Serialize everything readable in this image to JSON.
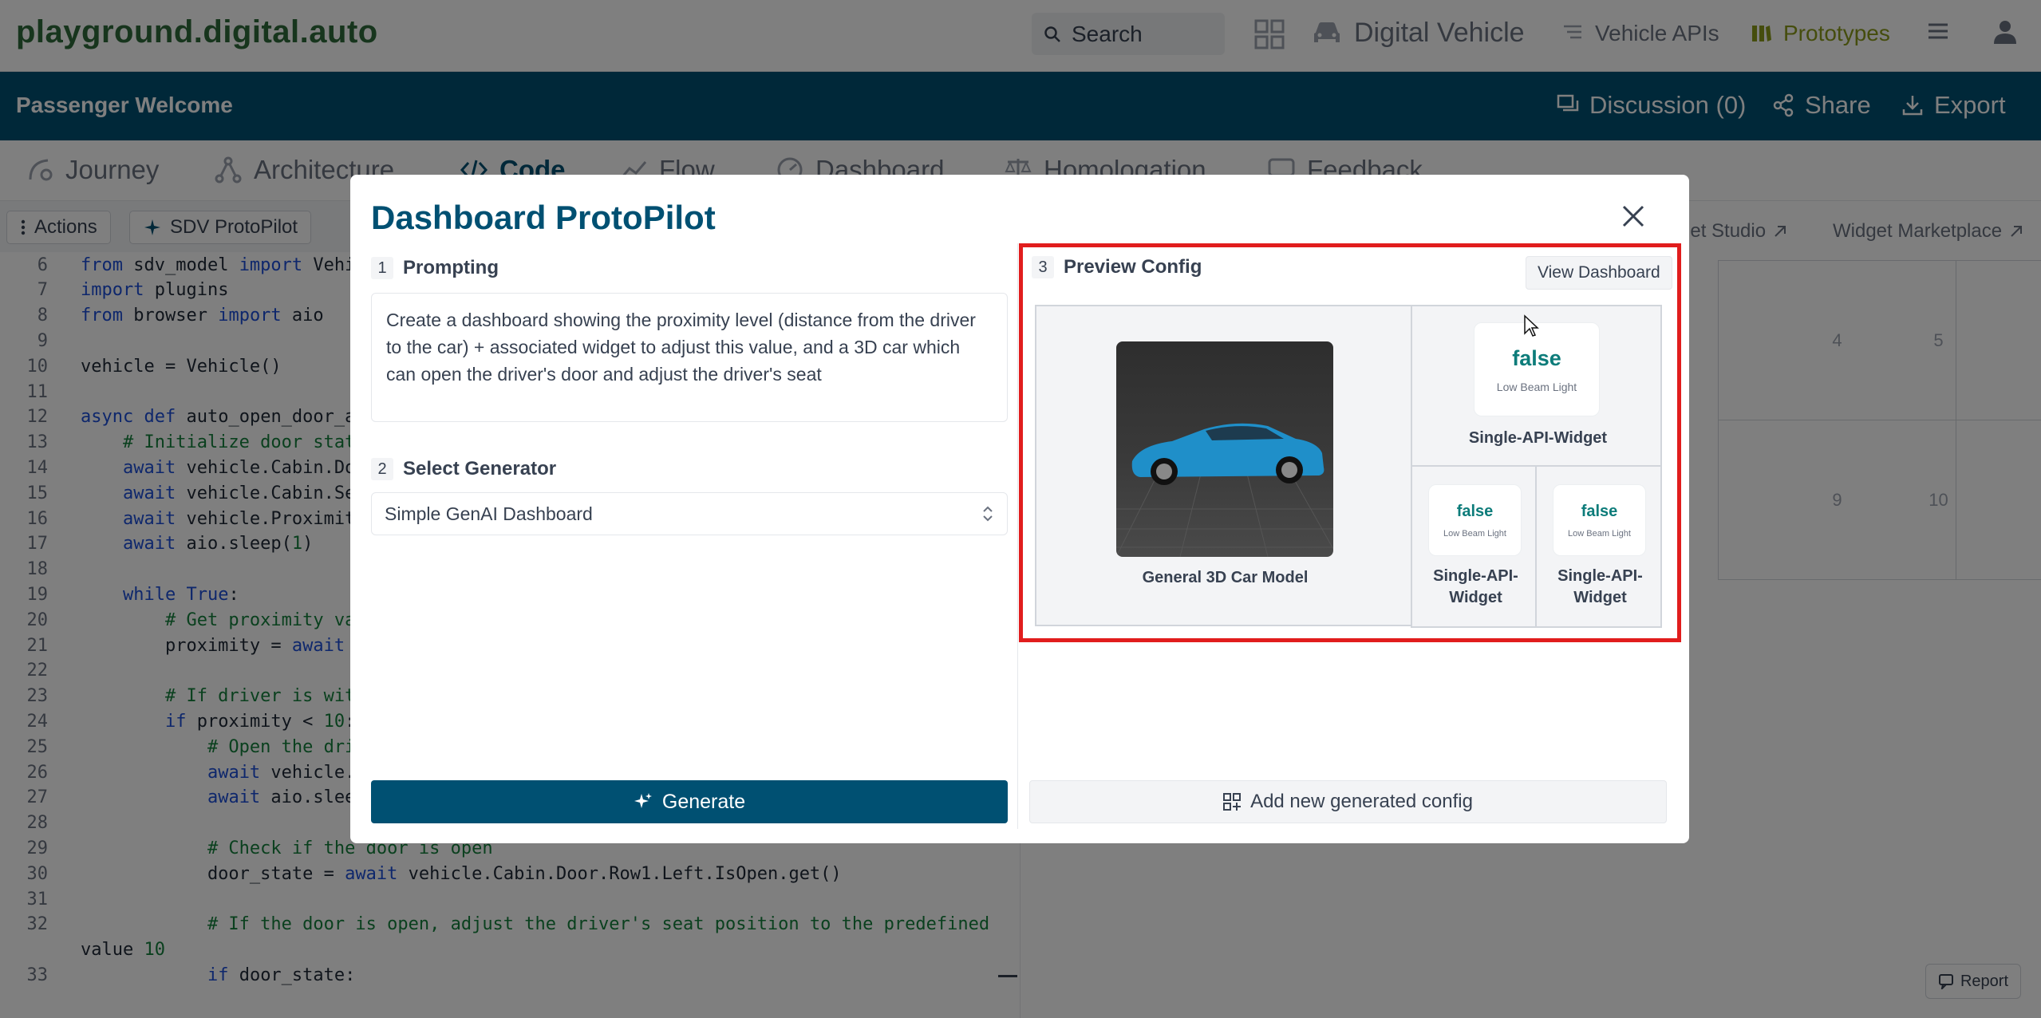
{
  "nav": {
    "logo": "playground.digital.auto",
    "search_label": "Search",
    "digital_vehicle": "Digital Vehicle",
    "vehicle_apis": "Vehicle APIs",
    "prototypes": "Prototypes"
  },
  "prototype": {
    "title": "Passenger Welcome",
    "discussion": "Discussion (0)",
    "share": "Share",
    "export": "Export"
  },
  "tabs": [
    "Journey",
    "Architecture",
    "Code",
    "Flow",
    "Dashboard",
    "Homologation",
    "Feedback"
  ],
  "code_toolbar": {
    "actions": "Actions",
    "protopilot": "SDV ProtoPilot"
  },
  "code_lines": [
    {
      "n": "6",
      "text": "from sdv_model import Vehi"
    },
    {
      "n": "7",
      "text": "import plugins"
    },
    {
      "n": "8",
      "text": "from browser import aio"
    },
    {
      "n": "9",
      "text": ""
    },
    {
      "n": "10",
      "text": "vehicle = Vehicle()"
    },
    {
      "n": "11",
      "text": ""
    },
    {
      "n": "12",
      "text": "async def auto_open_door_a"
    },
    {
      "n": "13",
      "text": "    # Initialize door stat"
    },
    {
      "n": "14",
      "text": "    await vehicle.Cabin.Do"
    },
    {
      "n": "15",
      "text": "    await vehicle.Cabin.Se"
    },
    {
      "n": "16",
      "text": "    await vehicle.Proximit"
    },
    {
      "n": "17",
      "text": "    await aio.sleep(1)"
    },
    {
      "n": "18",
      "text": ""
    },
    {
      "n": "19",
      "text": "    while True:"
    },
    {
      "n": "20",
      "text": "        # Get proximity va"
    },
    {
      "n": "21",
      "text": "        proximity = await"
    },
    {
      "n": "22",
      "text": ""
    },
    {
      "n": "23",
      "text": "        # If driver is wit"
    },
    {
      "n": "24",
      "text": "        if proximity < 10:"
    },
    {
      "n": "25",
      "text": "            # Open the dri"
    },
    {
      "n": "26",
      "text": "            await vehicle."
    },
    {
      "n": "27",
      "text": "            await aio.slee"
    },
    {
      "n": "28",
      "text": ""
    },
    {
      "n": "29",
      "text": "            # Check if the door is open"
    },
    {
      "n": "30",
      "text": "            door_state = await vehicle.Cabin.Door.Row1.Left.IsOpen.get()"
    },
    {
      "n": "31",
      "text": ""
    },
    {
      "n": "32",
      "text": "            # If the door is open, adjust the driver's seat position to the predefined"
    },
    {
      "n": "",
      "text": "value 10"
    },
    {
      "n": "33",
      "text": "            if door_state:"
    }
  ],
  "right_panel": {
    "widget_studio": "get Studio",
    "widget_marketplace": "Widget Marketplace",
    "cells": [
      "4",
      "5",
      "9",
      "10"
    ],
    "report": "Report"
  },
  "modal": {
    "title": "Dashboard ProtoPilot",
    "step1_num": "1",
    "step1_label": "Prompting",
    "prompt_text": "Create a dashboard showing the proximity level (distance from the driver to the car) + associated widget to adjust this value, and a 3D car which can open the driver's door and adjust the driver's seat",
    "step2_num": "2",
    "step2_label": "Select Generator",
    "generator_value": "Simple GenAI Dashboard",
    "generate_label": "Generate",
    "step3_num": "3",
    "step3_label": "Preview Config",
    "view_dashboard": "View Dashboard",
    "add_config": "Add new generated config",
    "preview": {
      "car_label": "General 3D Car Model",
      "widget_value": "false",
      "widget_sub": "Low Beam Light",
      "widget_label": "Single-API-Widget",
      "small_widget_label_1": "Single-API-",
      "small_widget_label_2": "Widget"
    }
  }
}
